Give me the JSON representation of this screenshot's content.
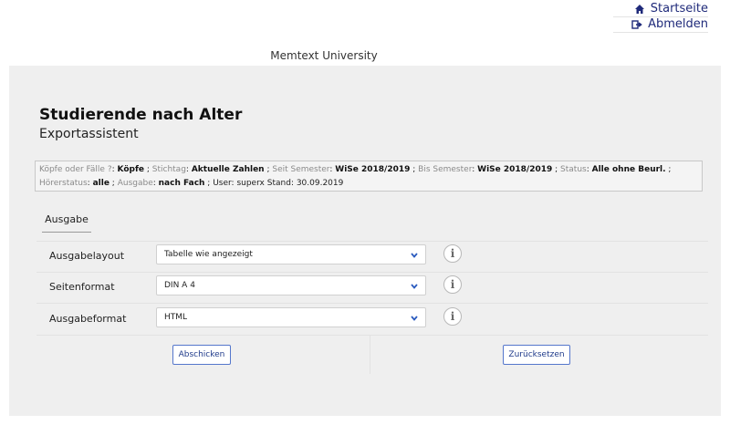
{
  "top_links": {
    "home": "Startseite",
    "logout": "Abmelden"
  },
  "university": "Memtext University",
  "page": {
    "title": "Studierende nach Alter",
    "subtitle": "Exportassistent"
  },
  "filters": [
    {
      "label": "Köpfe oder Fälle ?",
      "value": "Köpfe"
    },
    {
      "label": "Stichtag",
      "value": "Aktuelle Zahlen"
    },
    {
      "label": "Seit Semester",
      "value": "WiSe 2018/2019"
    },
    {
      "label": "Bis Semester",
      "value": "WiSe 2018/2019"
    },
    {
      "label": "Status",
      "value": "Alle ohne Beurl."
    },
    {
      "label": "Hörerstatus",
      "value": "alle"
    },
    {
      "label": "Ausgabe",
      "value": "nach Fach"
    }
  ],
  "user_text": "User: superx",
  "stand_text": "Stand: 30.09.2019",
  "tab": "Ausgabe",
  "form": {
    "layout": {
      "label": "Ausgabelayout",
      "value": "Tabelle wie angezeigt"
    },
    "page_format": {
      "label": "Seitenformat",
      "value": "DIN A 4"
    },
    "output_format": {
      "label": "Ausgabeformat",
      "value": "HTML"
    }
  },
  "info_glyph": "i",
  "buttons": {
    "submit": "Abschicken",
    "reset": "Zurücksetzen"
  },
  "colors": {
    "link": "#1f2a7a",
    "button_border": "#5577cc",
    "panel_bg": "#efefef"
  },
  "icons": {
    "home": "home-icon",
    "logout": "sign-out-icon",
    "dropdown": "chevron-down-icon",
    "info": "info-icon"
  }
}
